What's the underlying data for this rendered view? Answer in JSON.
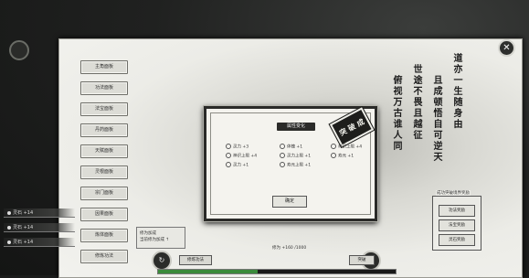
{
  "window": {
    "close_label": "✕"
  },
  "menu": {
    "items": [
      {
        "label": "主角面板"
      },
      {
        "label": "功法面板"
      },
      {
        "label": "法宝面板"
      },
      {
        "label": "丹药面板"
      },
      {
        "label": "天赋面板"
      },
      {
        "label": "灵根面板"
      },
      {
        "label": "宗门面板"
      },
      {
        "label": "因果面板"
      },
      {
        "label": "炼体面板"
      },
      {
        "label": "修炼功法"
      }
    ]
  },
  "poem": {
    "columns": [
      "道亦一生随身由",
      "且成顿悟自可逆天",
      "世途不畏且越征",
      "俯视万古谁人同"
    ]
  },
  "dialog": {
    "title": "属性变化",
    "seal": "突 破 成",
    "stats": [
      {
        "label": "灵力 +3"
      },
      {
        "label": "体魄 +1"
      },
      {
        "label": "神识上限 +4"
      },
      {
        "label": "神识上限 +4"
      },
      {
        "label": "灵力上限 +1"
      },
      {
        "label": "寿元 +1"
      },
      {
        "label": "灵力 +1"
      },
      {
        "label": "寿元上限 +1"
      }
    ],
    "confirm_label": "确定"
  },
  "left_status": [
    {
      "label": "灵石 +14"
    },
    {
      "label": "灵石 +14"
    },
    {
      "label": "灵石 +14"
    }
  ],
  "bottom": {
    "info_title": "修为加成",
    "info_line": "当前修为加成 ↑",
    "left_round_icon": "↻",
    "left_tag": "修炼功法",
    "center_caption": "修为 +160 /1000",
    "right_round_icon": "↻",
    "right_tag": "突破",
    "progress_fraction": 0.42
  },
  "right_panel": {
    "title": "成功突破境界奖励",
    "buttons": [
      {
        "label": "功法奖励"
      },
      {
        "label": "法宝奖励"
      },
      {
        "label": "灵石奖励"
      }
    ]
  }
}
